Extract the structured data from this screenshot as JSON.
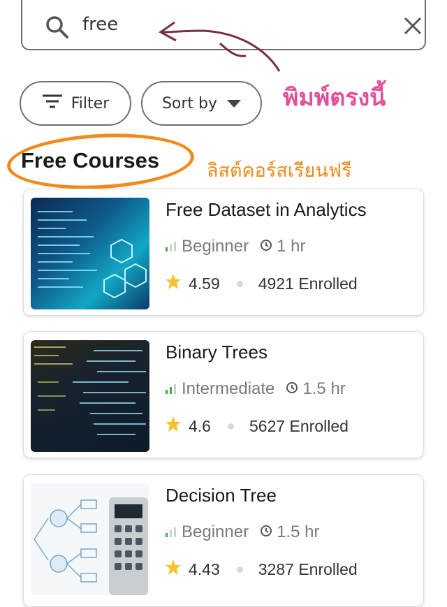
{
  "search": {
    "value": "free",
    "icon": "search-icon",
    "clear_icon": "close-icon"
  },
  "filter_button": {
    "label": "Filter",
    "icon": "filter-icon"
  },
  "sort_button": {
    "label": "Sort by",
    "icon": "dropdown-arrow-icon"
  },
  "section": {
    "title": "Free Courses"
  },
  "annotations": {
    "search_hint": "พิมพ์ตรงนี้",
    "list_hint": "ลิสต์คอร์สเรียนฟรี",
    "search_hint_color": "#e0509b",
    "list_hint_color": "#f08a1a",
    "ring_color": "#f28a1b"
  },
  "courses": [
    {
      "title": "Free Dataset in Analytics",
      "level": "Beginner",
      "duration": "1 hr",
      "rating": "4.59",
      "enrolled": "4921 Enrolled"
    },
    {
      "title": "Binary Trees",
      "level": "Intermediate",
      "duration": "1.5 hr",
      "rating": "4.6",
      "enrolled": "5627 Enrolled"
    },
    {
      "title": "Decision Tree",
      "level": "Beginner",
      "duration": "1.5 hr",
      "rating": "4.43",
      "enrolled": "3287 Enrolled"
    }
  ],
  "colors": {
    "level_bar_green": "#3cb043",
    "star": "#f6c232"
  }
}
